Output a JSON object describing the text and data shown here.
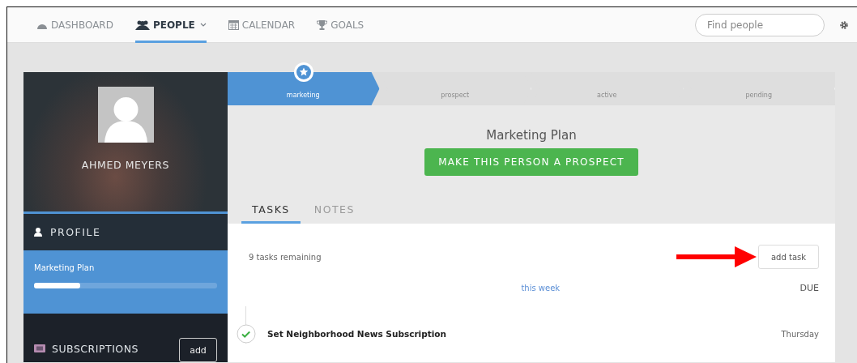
{
  "nav": {
    "items": [
      {
        "label": "DASHBOARD",
        "kind": "dashboard",
        "selected": false
      },
      {
        "label": "PEOPLE",
        "kind": "people",
        "selected": true
      },
      {
        "label": "CALENDAR",
        "kind": "calendar",
        "selected": false
      },
      {
        "label": "GOALS",
        "kind": "goals",
        "selected": false
      }
    ],
    "search": {
      "placeholder": "Find people"
    }
  },
  "profile": {
    "name": "AHMED MEYERS",
    "section": "PROFILE",
    "plan": {
      "label": "Marketing Plan",
      "level": 0.25
    },
    "subscriptions": {
      "label": "SUBSCRIPTIONS",
      "button": "add"
    }
  },
  "stages": [
    {
      "label": "marketing",
      "selected": true
    },
    {
      "label": "prospect",
      "selected": false
    },
    {
      "label": "active",
      "selected": false
    },
    {
      "label": "pending",
      "selected": false
    }
  ],
  "plan": {
    "title": "Marketing Plan",
    "action": "MAKE THIS PERSON A PROSPECT"
  },
  "tabs": [
    {
      "label": "TASKS",
      "selected": true
    },
    {
      "label": "NOTES",
      "selected": false
    }
  ],
  "tasks": {
    "remaining": "9 tasks remaining",
    "add_button": "add task",
    "group": "this week",
    "due_heading": "DUE",
    "items": [
      {
        "title": "Set Neighborhood News Subscription",
        "due": "Thursday",
        "checked": true
      }
    ]
  }
}
